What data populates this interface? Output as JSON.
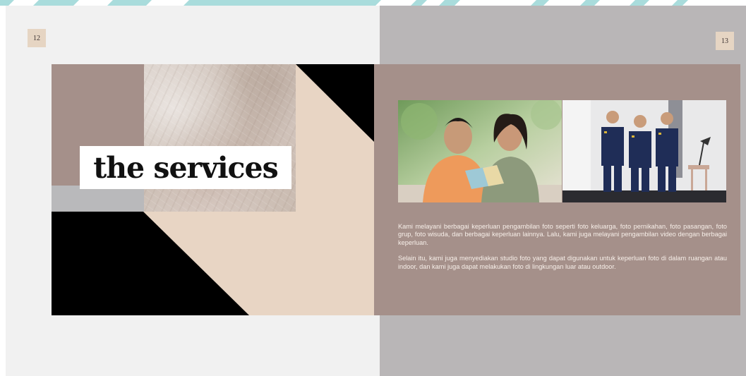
{
  "spread": {
    "left_page": {
      "page_number": "12",
      "title": "the services"
    },
    "right_page": {
      "page_number": "13",
      "images": [
        {
          "name": "couple-photo",
          "description_icon": "photo-icon"
        },
        {
          "name": "graduates-photo",
          "description_icon": "photo-icon"
        }
      ],
      "paragraphs": [
        "Kami melayani berbagai keperluan pengambilan foto seperti foto keluarga, foto pernikahan, foto pasangan, foto grup, foto wisuda, dan berbagai keperluan lainnya. Lalu, kami juga melayani pengambilan video dengan berbagai keperluan.",
        "Selain itu, kami juga menyediakan studio foto yang dapat digunakan untuk keperluan foto di dalam ruangan atau indoor, dan kami juga dapat melakukan foto di lingkungan luar atau outdoor."
      ]
    }
  },
  "colors": {
    "left_page_bg": "#f1f1f1",
    "right_page_bg": "#b9b6b7",
    "mauve": "#a5908a",
    "beige": "#e8d5c4",
    "black": "#000000",
    "stripe_teal": "#a9dcdc",
    "page_number_bg": "#e6d5c3"
  }
}
